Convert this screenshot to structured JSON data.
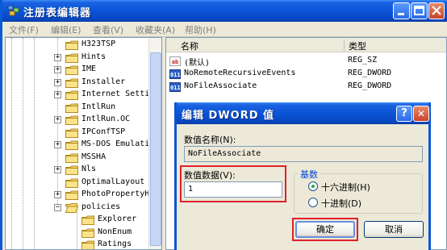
{
  "window": {
    "title": "注册表编辑器",
    "menu": [
      "文件(F)",
      "编辑(E)",
      "查看(V)",
      "收藏夹(A)",
      "帮助(H)"
    ]
  },
  "tree": {
    "items": [
      {
        "label": "H323TSP",
        "expandable": false
      },
      {
        "label": "Hints",
        "expandable": true
      },
      {
        "label": "IME",
        "expandable": true
      },
      {
        "label": "Installer",
        "expandable": true
      },
      {
        "label": "Internet Setti",
        "expandable": true
      },
      {
        "label": "IntlRun",
        "expandable": false
      },
      {
        "label": "IntlRun.OC",
        "expandable": true
      },
      {
        "label": "IPConfTSP",
        "expandable": false
      },
      {
        "label": "MS-DOS Emulati",
        "expandable": true
      },
      {
        "label": "MSSHA",
        "expandable": false
      },
      {
        "label": "Nls",
        "expandable": true
      },
      {
        "label": "OptimalLayout",
        "expandable": false
      },
      {
        "label": "PhotoPropertyH",
        "expandable": true
      },
      {
        "label": "policies",
        "expandable": true,
        "expanded": true
      },
      {
        "label": "Explorer",
        "expandable": false,
        "child": true
      },
      {
        "label": "NonEnum",
        "expandable": false,
        "child": true
      },
      {
        "label": "Ratings",
        "expandable": false,
        "child": true
      }
    ]
  },
  "list": {
    "columns": {
      "name": "名称",
      "type": "类型"
    },
    "rows": [
      {
        "icon": "ab",
        "name": "(默认)",
        "type": "REG_SZ"
      },
      {
        "icon": "011",
        "name": "NoRemoteRecursiveEvents",
        "type": "REG_DWORD"
      },
      {
        "icon": "011",
        "name": "NoFileAssociate",
        "type": "REG_DWORD"
      }
    ]
  },
  "dialog": {
    "title": "编辑 DWORD 值",
    "help_label": "?",
    "close_label": "✕",
    "value_name_label": "数值名称(N):",
    "value_name": "NoFileAssociate",
    "value_data_label": "数值数据(V):",
    "value_data": "1",
    "base_label": "基数",
    "hex_label": "十六进制(H)",
    "dec_label": "十进制(D)",
    "selected_base": "hex",
    "ok_label": "确定",
    "cancel_label": "取消"
  },
  "colors": {
    "title_blue": "#0a54d6",
    "highlight_red": "#e0202a"
  }
}
